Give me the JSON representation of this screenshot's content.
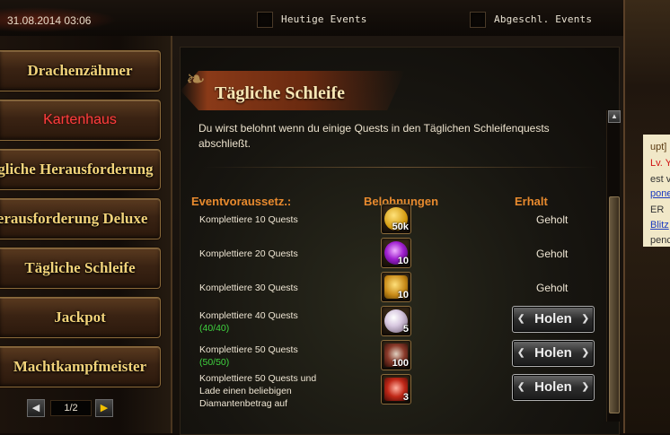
{
  "topbar": {
    "datetime": "31.08.2014 03:06",
    "checkboxes": [
      {
        "label": "Heutige Events",
        "checked": false
      },
      {
        "label": "Abgeschl. Events",
        "checked": false
      }
    ]
  },
  "menu": {
    "items": [
      {
        "label": "Drachenzähmer",
        "active": false
      },
      {
        "label": "Kartenhaus",
        "active": true
      },
      {
        "label": "Tägliche Herausforderung",
        "active": false
      },
      {
        "label": "Herausforderung Deluxe",
        "active": false
      },
      {
        "label": "Tägliche Schleife",
        "active": false
      },
      {
        "label": "Jackpot",
        "active": false
      },
      {
        "label": "Machtkampfmeister",
        "active": false
      }
    ],
    "pager": {
      "text": "1/2",
      "prev": "◀",
      "next": "▶"
    }
  },
  "panel": {
    "title": "Tägliche Schleife",
    "description": "Du wirst belohnt wenn du einige Quests in den Täglichen Schleifenquests abschließt.",
    "headers": {
      "condition": "Eventvoraussetz.:",
      "rewards": "Belohnungen",
      "status": "Erhalt"
    },
    "rows": [
      {
        "label": "Komplettiere 10 Quests",
        "progress": "",
        "reward_qty": "50k",
        "reward_icon": "gold-coin-icon",
        "status": "Geholt",
        "button": ""
      },
      {
        "label": "Komplettiere 20 Quests",
        "progress": "",
        "reward_qty": "10",
        "reward_icon": "purple-orb-icon",
        "status": "Geholt",
        "button": ""
      },
      {
        "label": "Komplettiere 30 Quests",
        "progress": "",
        "reward_qty": "10",
        "reward_icon": "gold-medal-icon",
        "status": "Geholt",
        "button": ""
      },
      {
        "label": "Komplettiere 40 Quests",
        "progress": "(40/40)",
        "reward_qty": "5",
        "reward_icon": "pearl-icon",
        "status": "",
        "button": "Holen"
      },
      {
        "label": "Komplettiere 50 Quests",
        "progress": "(50/50)",
        "reward_qty": "100",
        "reward_icon": "emblem-icon",
        "status": "",
        "button": "Holen"
      },
      {
        "label": "Komplettiere 50 Quests und Lade einen beliebigen Diamantenbetrag auf",
        "progress": "",
        "reward_qty": "3",
        "reward_icon": "card-pack-icon",
        "status": "",
        "button": "Holen"
      }
    ]
  },
  "right_sliver": {
    "texts": [
      "upt]",
      "Lv. Y",
      "est v",
      "pone",
      "ER",
      "Blitz",
      "penc"
    ]
  },
  "colors": {
    "accent_orange": "#e88a2e",
    "progress_green": "#3fd23f",
    "menu_gold": "#f2d37a",
    "active_red": "#ff3d3d"
  }
}
